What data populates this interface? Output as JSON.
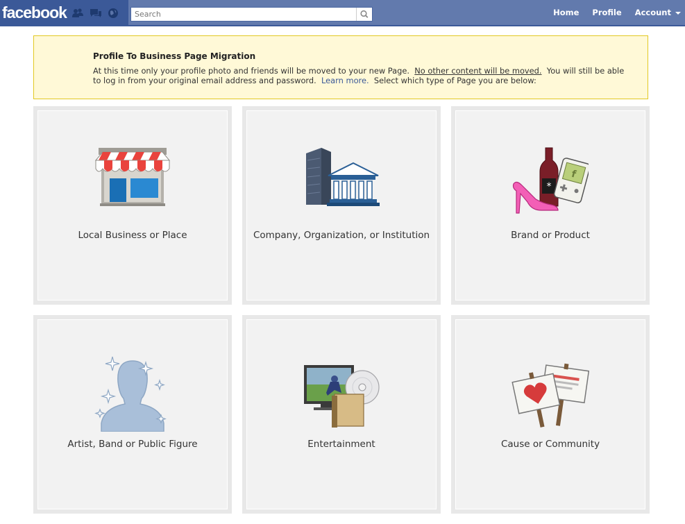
{
  "header": {
    "logo": "facebook",
    "search_placeholder": "Search",
    "nav": {
      "home": "Home",
      "profile": "Profile",
      "account": "Account"
    }
  },
  "notice": {
    "title": "Profile To Business Page Migration",
    "text_before": "At this time only your profile photo and friends will be moved to your new Page.",
    "text_underlined": "No other content will be moved.",
    "text_mid": "You will still be able to log in from your original email address and password.",
    "link": "Learn more.",
    "text_after": "Select which type of Page you are below:"
  },
  "tiles": [
    {
      "label": "Local Business or Place",
      "icon": "storefront-icon"
    },
    {
      "label": "Company, Organization, or Institution",
      "icon": "buildings-icon"
    },
    {
      "label": "Brand or Product",
      "icon": "products-icon"
    },
    {
      "label": "Artist, Band or Public Figure",
      "icon": "person-silhouette-icon"
    },
    {
      "label": "Entertainment",
      "icon": "tv-disc-book-icon"
    },
    {
      "label": "Cause or Community",
      "icon": "protest-signs-icon"
    }
  ],
  "colors": {
    "header_blue": "#3b5998",
    "notice_bg": "#fff9d7",
    "notice_border": "#e2c822",
    "tile_bg": "#f2f2f2"
  }
}
